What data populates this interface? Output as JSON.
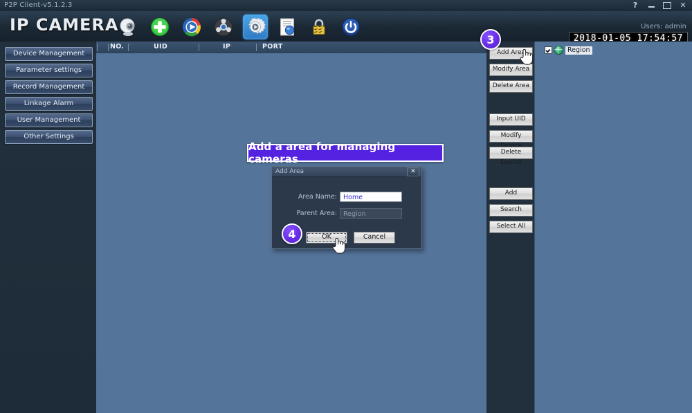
{
  "window": {
    "title": "P2P Client-v5.1.2.3",
    "controls": [
      {
        "name": "help-button",
        "label": "?"
      },
      {
        "name": "minimize-button",
        "label": ""
      },
      {
        "name": "maximize-button",
        "label": ""
      },
      {
        "name": "close-button",
        "label": "✕"
      }
    ]
  },
  "header": {
    "brand": "IP CAMERA",
    "user_label": "Users: admin",
    "datetime": "2018-01-05 17:54:57",
    "toolbar": [
      {
        "name": "camera-icon",
        "selected": false
      },
      {
        "name": "add-icon",
        "selected": false
      },
      {
        "name": "play-icon",
        "selected": false
      },
      {
        "name": "playback-reel-icon",
        "selected": false
      },
      {
        "name": "settings-gear-icon",
        "selected": true
      },
      {
        "name": "log-document-icon",
        "selected": false
      },
      {
        "name": "lock-icon",
        "selected": false
      },
      {
        "name": "power-icon",
        "selected": false
      }
    ]
  },
  "sidebar": {
    "items": [
      {
        "label": "Device Management"
      },
      {
        "label": "Parameter settings"
      },
      {
        "label": "Record Management"
      },
      {
        "label": "Linkage Alarm"
      },
      {
        "label": "User Management"
      },
      {
        "label": "Other Settings"
      }
    ]
  },
  "device_list": {
    "columns": [
      "NO.",
      "UID",
      "IP",
      "PORT"
    ],
    "rows": []
  },
  "action_panel": {
    "groups": [
      [
        {
          "label": "Add Area"
        },
        {
          "label": "Modify Area"
        },
        {
          "label": "Delete Area"
        }
      ],
      [
        {
          "label": "Input UID"
        },
        {
          "label": "Modify Device"
        },
        {
          "label": "Delete Device"
        }
      ],
      [
        {
          "label": "Add"
        },
        {
          "label": "Search"
        },
        {
          "label": "Select All"
        }
      ]
    ]
  },
  "tree_panel": {
    "items": [
      {
        "label": "Region",
        "checked": true,
        "selected": true,
        "icon": "globe-icon"
      }
    ]
  },
  "annotation": {
    "banner_text": "Add a area for managing cameras",
    "banner_color": "#5422e0",
    "markers": [
      {
        "number": "3",
        "target": "add-area-button"
      },
      {
        "number": "4",
        "target": "ok-button"
      }
    ],
    "marker_color": "#6b2fe8"
  },
  "dialog": {
    "title": "Add Area",
    "close_label": "✕",
    "fields": [
      {
        "label": "Area Name:",
        "value": "Home",
        "placeholder": "",
        "disabled": false
      },
      {
        "label": "Parent Area:",
        "value": "Region",
        "placeholder": "",
        "disabled": true
      }
    ],
    "buttons": [
      {
        "label": "OK"
      },
      {
        "label": "Cancel"
      }
    ]
  }
}
